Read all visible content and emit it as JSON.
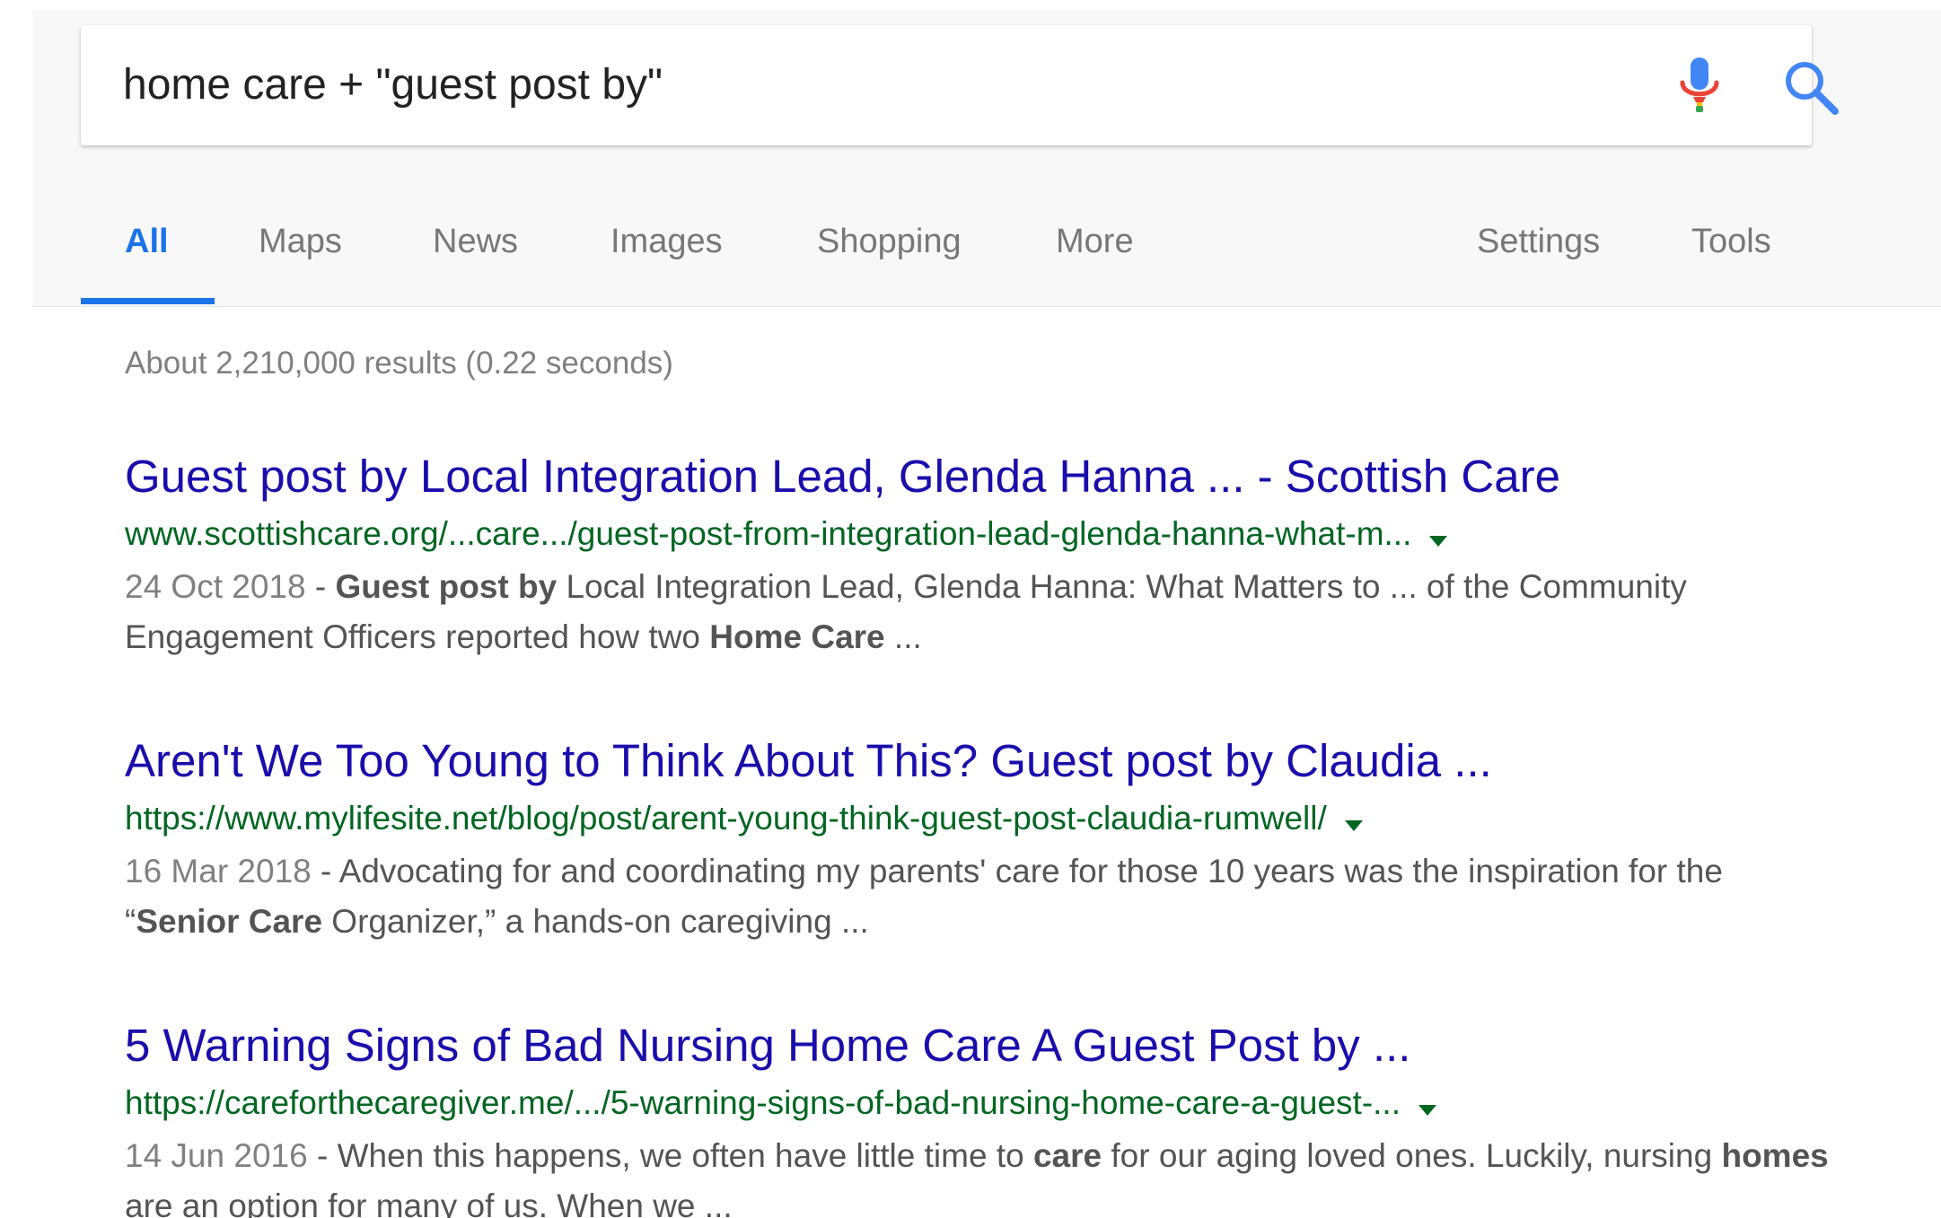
{
  "search": {
    "query": "home care + \"guest post by\"",
    "mic_icon": "microphone-icon",
    "search_icon": "magnifier-icon"
  },
  "tabs": [
    {
      "label": "All",
      "active": true
    },
    {
      "label": "Maps"
    },
    {
      "label": "News"
    },
    {
      "label": "Images"
    },
    {
      "label": "Shopping"
    },
    {
      "label": "More"
    },
    {
      "label": "Settings"
    },
    {
      "label": "Tools"
    }
  ],
  "colors": {
    "accent": "#1a73e8",
    "link": "#1a0dab",
    "url": "#006621",
    "snippet": "#545454"
  },
  "stats": "About 2,210,000 results (0.22 seconds)",
  "results": [
    {
      "title": "Guest post by Local Integration Lead, Glenda Hanna ... - Scottish Care",
      "url": "www.scottishcare.org/...care.../guest-post-from-integration-lead-glenda-hanna-what-m...",
      "date": "24 Oct 2018",
      "snippet_parts": [
        {
          "text": "Guest post by",
          "bold": true
        },
        {
          "text": " Local Integration Lead, Glenda Hanna: What Matters to ... of the Community Engagement Officers reported how two "
        },
        {
          "text": "Home Care",
          "bold": true
        },
        {
          "text": " ..."
        }
      ]
    },
    {
      "title": "Aren't We Too Young to Think About This? Guest post by Claudia ...",
      "url": "https://www.mylifesite.net/blog/post/arent-young-think-guest-post-claudia-rumwell/",
      "date": "16 Mar 2018",
      "snippet_parts": [
        {
          "text": "Advocating for and coordinating my parents' care for those 10 years was the inspiration for the “"
        },
        {
          "text": "Senior Care",
          "bold": true
        },
        {
          "text": " Organizer,” a hands-on caregiving ..."
        }
      ]
    },
    {
      "title": "5 Warning Signs of Bad Nursing Home Care A Guest Post by ...",
      "url": "https://careforthecaregiver.me/.../5-warning-signs-of-bad-nursing-home-care-a-guest-...",
      "date": "14 Jun 2016",
      "snippet_parts": [
        {
          "text": "When this happens, we often have little time to "
        },
        {
          "text": "care",
          "bold": true
        },
        {
          "text": " for our aging loved ones. Luckily, nursing "
        },
        {
          "text": "homes",
          "bold": true
        },
        {
          "text": " are an option for many of us. When we ..."
        }
      ]
    }
  ]
}
